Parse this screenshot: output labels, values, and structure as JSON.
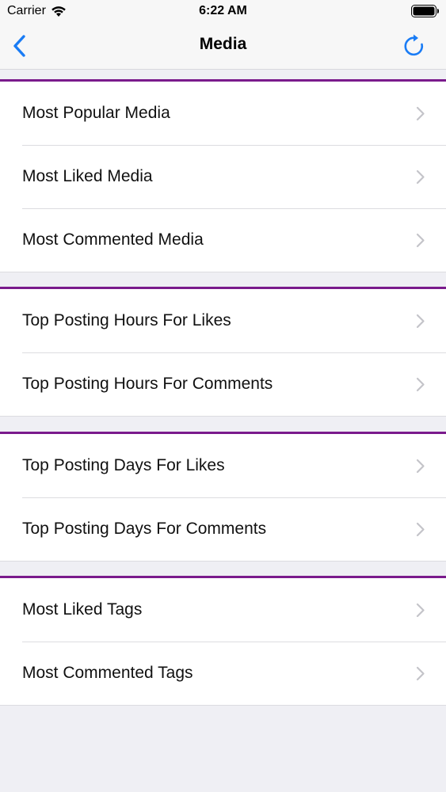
{
  "status_bar": {
    "carrier": "Carrier",
    "time": "6:22 AM",
    "wifi_icon": "wifi-icon",
    "battery_icon": "battery-icon"
  },
  "nav": {
    "title": "Media",
    "back_icon": "chevron-left-icon",
    "refresh_icon": "refresh-icon",
    "accent_color": "#1a7cf5"
  },
  "section_border_color": "#7a1a8c",
  "sections": [
    {
      "items": [
        {
          "label": "Most Popular Media"
        },
        {
          "label": "Most Liked Media"
        },
        {
          "label": "Most Commented Media"
        }
      ]
    },
    {
      "items": [
        {
          "label": "Top Posting Hours For Likes"
        },
        {
          "label": "Top Posting Hours For Comments"
        }
      ]
    },
    {
      "items": [
        {
          "label": "Top Posting Days For Likes"
        },
        {
          "label": "Top Posting Days For Comments"
        }
      ]
    },
    {
      "items": [
        {
          "label": "Most Liked Tags"
        },
        {
          "label": "Most Commented Tags"
        }
      ]
    }
  ]
}
